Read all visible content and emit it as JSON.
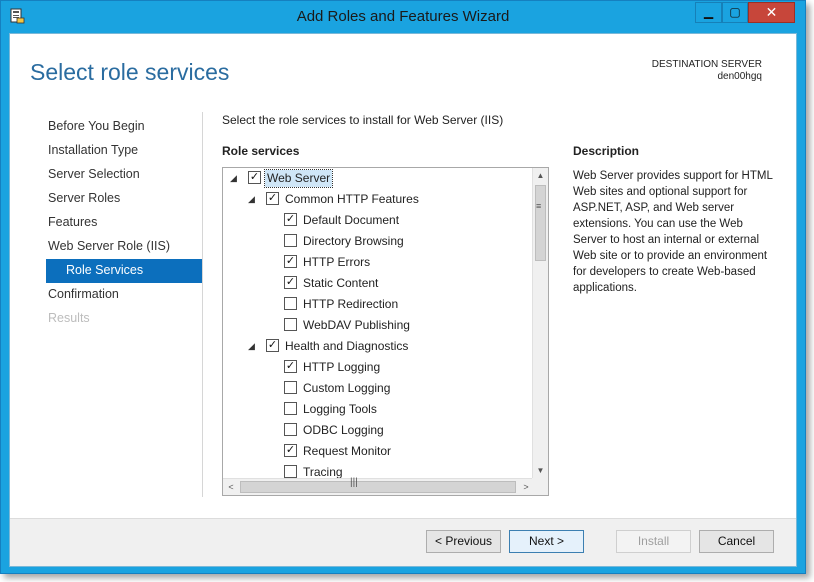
{
  "window": {
    "title": "Add Roles and Features Wizard",
    "minimize_glyph": "▁",
    "maximize_glyph": "▢",
    "close_glyph": "✕"
  },
  "header": {
    "page_title": "Select role services",
    "destination_label": "DESTINATION SERVER",
    "destination_server": "den00hgq"
  },
  "nav": {
    "items": [
      {
        "label": "Before You Begin",
        "state": "normal"
      },
      {
        "label": "Installation Type",
        "state": "normal"
      },
      {
        "label": "Server Selection",
        "state": "normal"
      },
      {
        "label": "Server Roles",
        "state": "normal"
      },
      {
        "label": "Features",
        "state": "normal"
      },
      {
        "label": "Web Server Role (IIS)",
        "state": "normal"
      },
      {
        "label": "Role Services",
        "state": "active"
      },
      {
        "label": "Confirmation",
        "state": "normal"
      },
      {
        "label": "Results",
        "state": "disabled"
      }
    ]
  },
  "main": {
    "instruction": "Select the role services to install for Web Server (IIS)",
    "role_services_heading": "Role services",
    "tree": [
      {
        "label": "Web Server",
        "level": 0,
        "expanded": true,
        "checked": true,
        "selected": true
      },
      {
        "label": "Common HTTP Features",
        "level": 1,
        "expanded": true,
        "checked": true
      },
      {
        "label": "Default Document",
        "level": 2,
        "checked": true
      },
      {
        "label": "Directory Browsing",
        "level": 2,
        "checked": false
      },
      {
        "label": "HTTP Errors",
        "level": 2,
        "checked": true
      },
      {
        "label": "Static Content",
        "level": 2,
        "checked": true
      },
      {
        "label": "HTTP Redirection",
        "level": 2,
        "checked": false
      },
      {
        "label": "WebDAV Publishing",
        "level": 2,
        "checked": false
      },
      {
        "label": "Health and Diagnostics",
        "level": 1,
        "expanded": true,
        "checked": true
      },
      {
        "label": "HTTP Logging",
        "level": 2,
        "checked": true
      },
      {
        "label": "Custom Logging",
        "level": 2,
        "checked": false
      },
      {
        "label": "Logging Tools",
        "level": 2,
        "checked": false
      },
      {
        "label": "ODBC Logging",
        "level": 2,
        "checked": false
      },
      {
        "label": "Request Monitor",
        "level": 2,
        "checked": true
      },
      {
        "label": "Tracing",
        "level": 2,
        "checked": false
      }
    ],
    "description_heading": "Description",
    "description_text": "Web Server provides support for HTML Web sites and optional support for ASP.NET, ASP, and Web server extensions. You can use the Web Server to host an internal or external Web site or to provide an environment for developers to create Web-based applications."
  },
  "footer": {
    "previous_label": "< Previous",
    "next_label": "Next >",
    "install_label": "Install",
    "cancel_label": "Cancel"
  },
  "colors": {
    "titlebar": "#1aa3e0",
    "accent": "#2a6ca0",
    "nav_active": "#0c6fbd",
    "close_button": "#c7463a"
  }
}
